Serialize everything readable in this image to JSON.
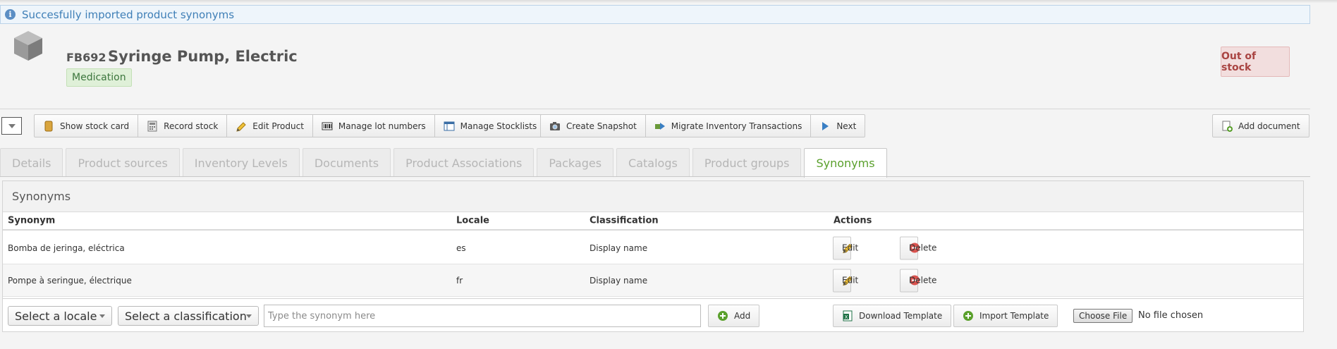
{
  "flash": {
    "message": "Succesfully imported product synonyms"
  },
  "product": {
    "code": "FB692",
    "name": "Syringe Pump, Electric",
    "category": "Medication",
    "stock_status": "Out of stock"
  },
  "toolbar": {
    "group1": [
      {
        "label": "Show stock card",
        "icon": "stock-card-icon"
      },
      {
        "label": "Record stock",
        "icon": "record-stock-icon"
      },
      {
        "label": "Edit Product",
        "icon": "pencil-icon"
      },
      {
        "label": "Manage lot numbers",
        "icon": "barcode-icon"
      },
      {
        "label": "Manage Stocklists",
        "icon": "list-icon"
      }
    ],
    "group2": [
      {
        "label": "Create Snapshot",
        "icon": "camera-icon"
      },
      {
        "label": "Migrate Inventory Transactions",
        "icon": "migrate-icon"
      },
      {
        "label": "Next",
        "icon": "play-icon"
      }
    ],
    "add_document": "Add document"
  },
  "tabs": [
    {
      "label": "Details",
      "active": false
    },
    {
      "label": "Product sources",
      "active": false
    },
    {
      "label": "Inventory Levels",
      "active": false
    },
    {
      "label": "Documents",
      "active": false
    },
    {
      "label": "Product Associations",
      "active": false
    },
    {
      "label": "Packages",
      "active": false
    },
    {
      "label": "Catalogs",
      "active": false
    },
    {
      "label": "Product groups",
      "active": false
    },
    {
      "label": "Synonyms",
      "active": true
    }
  ],
  "synonyms": {
    "title": "Synonyms",
    "columns": {
      "synonym": "Synonym",
      "locale": "Locale",
      "classification": "Classification",
      "actions": "Actions"
    },
    "rows": [
      {
        "synonym": "Bomba de jeringa, eléctrica",
        "locale": "es",
        "classification": "Display name"
      },
      {
        "synonym": "Pompe à seringue, électrique",
        "locale": "fr",
        "classification": "Display name"
      }
    ],
    "edit_label": "Edit",
    "delete_label": "Delete",
    "form": {
      "locale_select": "Select a locale",
      "classification_select": "Select a classification",
      "synonym_placeholder": "Type the synonym here",
      "add_label": "Add",
      "download_template": "Download Template",
      "import_template": "Import Template",
      "choose_file": "Choose File",
      "no_file": "No file chosen"
    }
  },
  "colors": {
    "accent_green": "#5aa02c",
    "info_blue": "#3f7fb7",
    "danger_red": "#a94442"
  }
}
